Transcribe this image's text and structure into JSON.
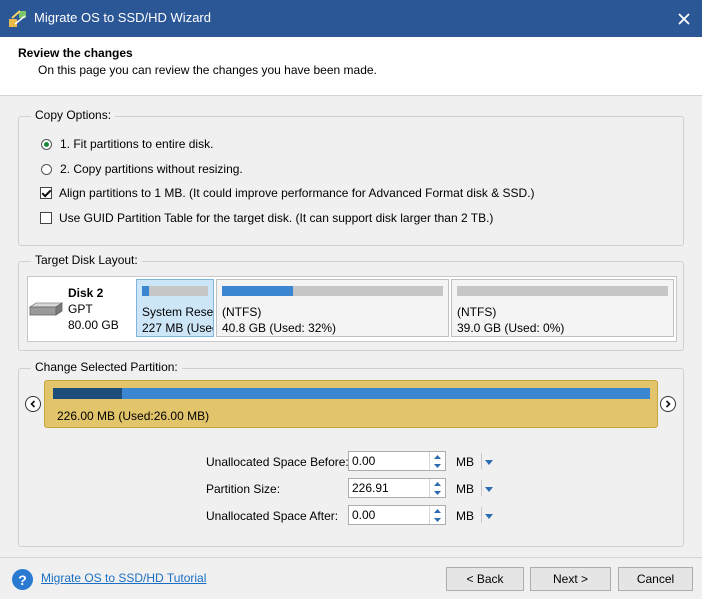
{
  "window": {
    "title": "Migrate OS to SSD/HD Wizard"
  },
  "header": {
    "title": "Review the changes",
    "subtitle": "On this page you can review the changes you have been made."
  },
  "copy_options": {
    "legend": "Copy Options:",
    "option1": "1. Fit partitions to entire disk.",
    "option2": "2. Copy partitions without resizing.",
    "align": "Align partitions to 1 MB.  (It could improve performance for Advanced Format disk & SSD.)",
    "guid": "Use GUID Partition Table for the target disk. (It can support disk larger than 2 TB.)",
    "option1_selected": true,
    "align_checked": true,
    "guid_checked": false
  },
  "target_layout": {
    "legend": "Target Disk Layout:",
    "disk": {
      "name": "Disk 2",
      "type": "GPT",
      "size": "80.00 GB"
    },
    "partitions": [
      {
        "label": "System Reser",
        "detail": "227 MB (Used",
        "used_fraction": 0.11,
        "selected": true
      },
      {
        "label": "(NTFS)",
        "detail": "40.8 GB (Used: 32%)",
        "used_fraction": 0.32,
        "selected": false
      },
      {
        "label": "(NTFS)",
        "detail": "39.0 GB (Used: 0%)",
        "used_fraction": 0.0,
        "selected": false
      }
    ]
  },
  "change_partition": {
    "legend": "Change Selected Partition:",
    "bar_label": "226.00 MB (Used:26.00 MB)",
    "used_fraction": 0.115,
    "fields": {
      "before_label": "Unallocated Space Before:",
      "before_value": "0.00",
      "size_label": "Partition Size:",
      "size_value": "226.91",
      "after_label": "Unallocated Space After:",
      "after_value": "0.00",
      "unit": "MB"
    }
  },
  "footer": {
    "help_link": "Migrate OS to SSD/HD Tutorial",
    "back": "< Back",
    "next": "Next >",
    "cancel": "Cancel"
  }
}
